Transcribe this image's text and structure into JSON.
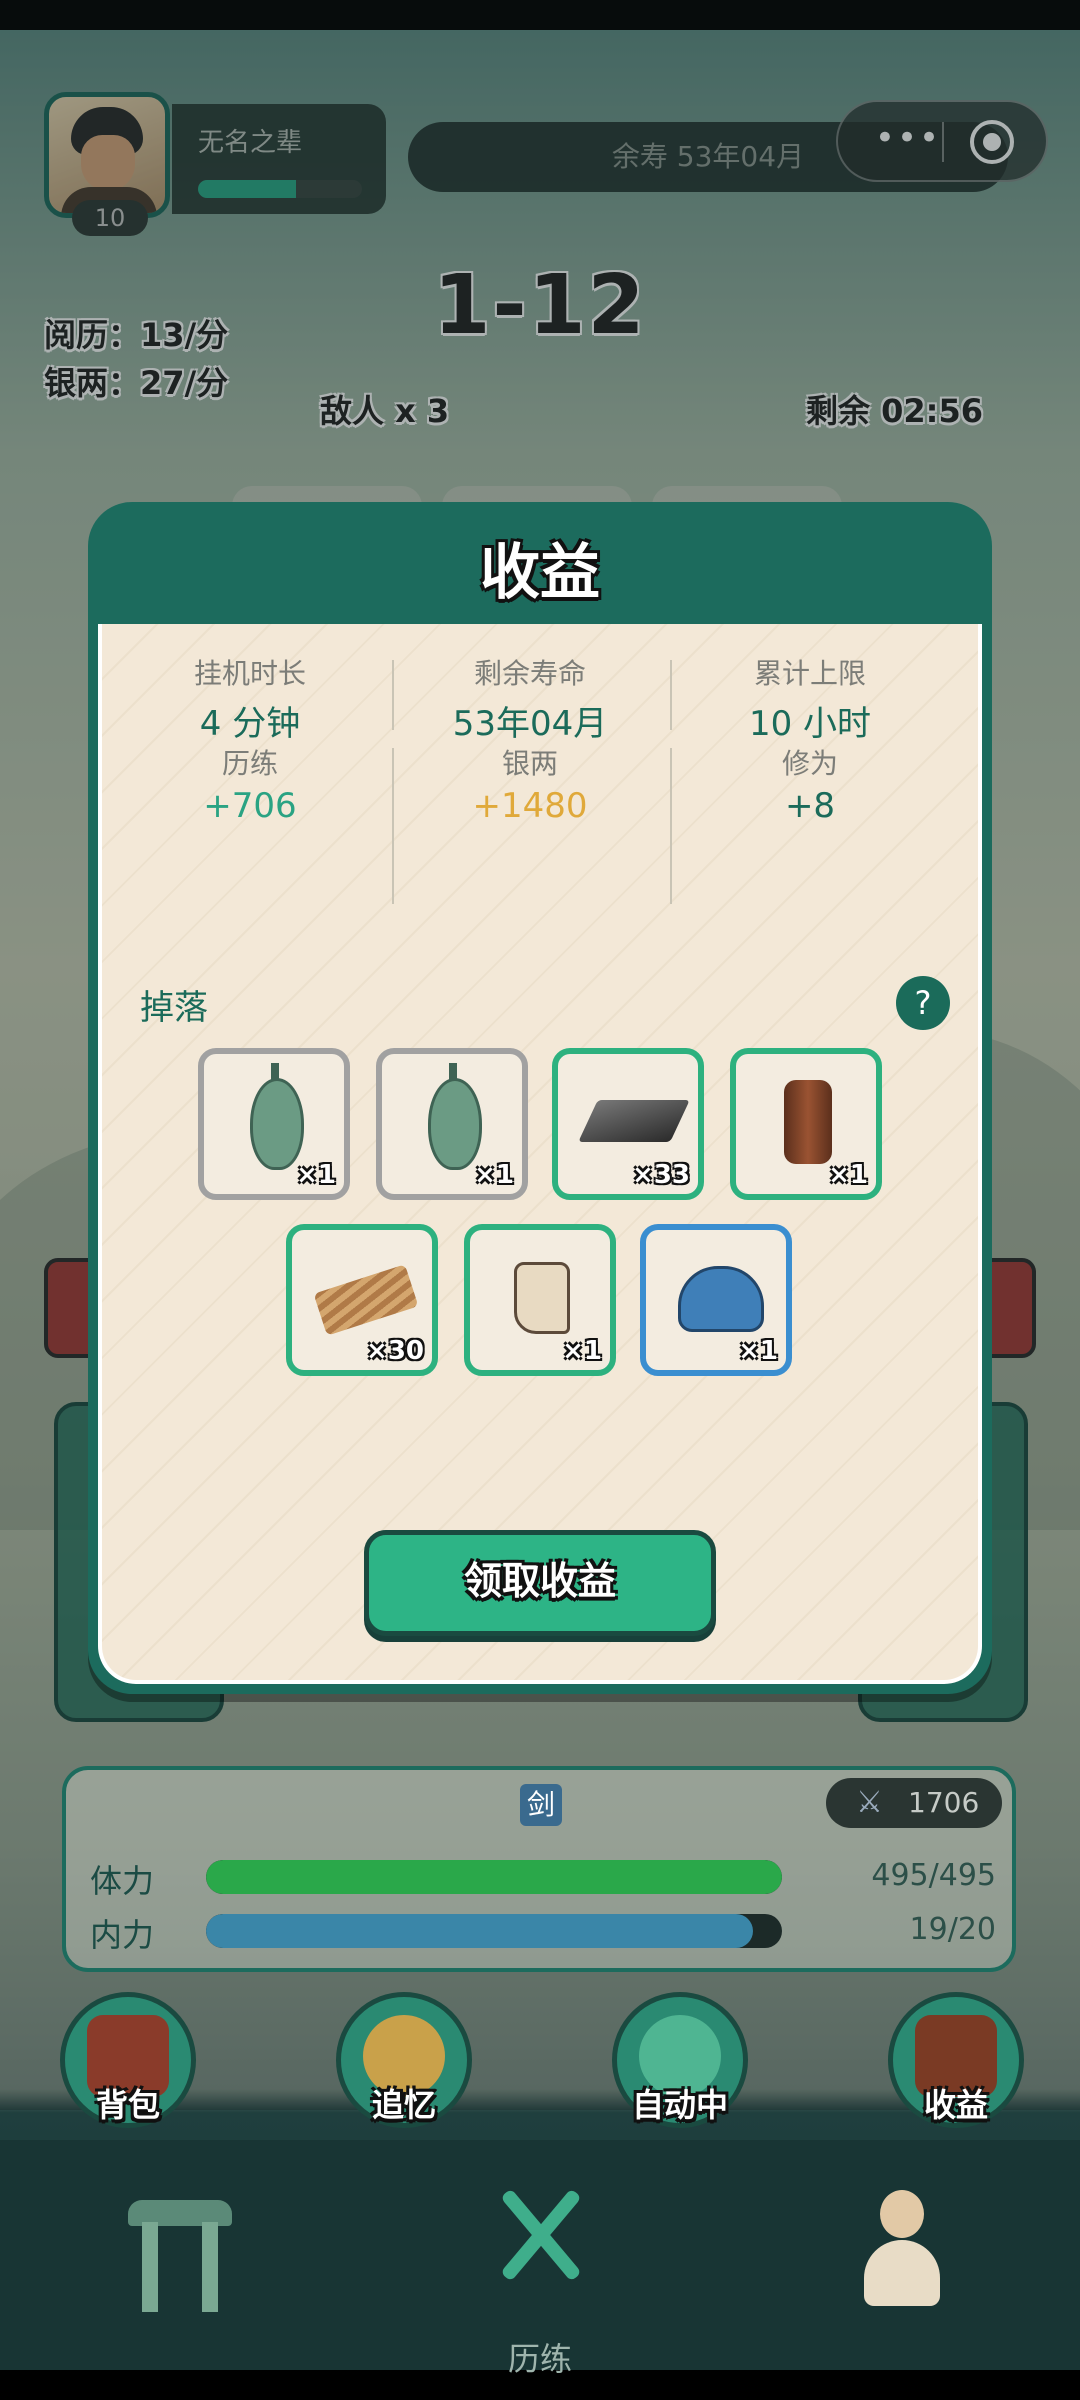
{
  "header": {
    "player_name": "无名之辈",
    "level": "10",
    "name_progress": 0.6,
    "remaining_life": "余寿 53年04月",
    "more_icon": "more-dots-icon",
    "close_icon": "target-circle-icon"
  },
  "battle": {
    "stage": "1-12",
    "experience_rate": "阅历：13/分",
    "silver_rate": "银两：27/分",
    "enemies": "敌人 x 3",
    "remaining_time": "剩余 02:56"
  },
  "modal": {
    "title": "收益",
    "stats": [
      {
        "label": "挂机时长",
        "value": "4 分钟",
        "color": "#1b6b5a"
      },
      {
        "label": "剩余寿命",
        "value": "53年04月",
        "color": "#1b6b5a"
      },
      {
        "label": "累计上限",
        "value": "10 小时",
        "color": "#1b6b5a"
      },
      {
        "label": "历练",
        "value": "+706",
        "color": "#2aa383"
      },
      {
        "label": "银两",
        "value": "+1480",
        "color": "#e0a93a"
      },
      {
        "label": "修为",
        "value": "+8",
        "color": "#1b6b5a"
      }
    ],
    "drops_label": "掉落",
    "help_label": "?",
    "items": [
      {
        "name": "jade-pendant-icon",
        "count": "×1",
        "rarity": "gray"
      },
      {
        "name": "jade-pendant-icon",
        "count": "×1",
        "rarity": "gray"
      },
      {
        "name": "iron-ingot-icon",
        "count": "×33",
        "rarity": "green"
      },
      {
        "name": "leather-bracer-icon",
        "count": "×1",
        "rarity": "green"
      },
      {
        "name": "wood-sticks-icon",
        "count": "×30",
        "rarity": "green"
      },
      {
        "name": "cloth-boot-icon",
        "count": "×1",
        "rarity": "green"
      },
      {
        "name": "blue-hat-icon",
        "count": "×1",
        "rarity": "blue"
      }
    ],
    "claim_button": "领取收益"
  },
  "panel": {
    "weapon": "剑",
    "power": "1706",
    "stamina_label": "体力",
    "stamina_value": "495/495",
    "stamina_ratio": 1.0,
    "inner_label": "内力",
    "inner_value": "19/20",
    "inner_ratio": 0.95
  },
  "actions": [
    "背包",
    "追忆",
    "自动中",
    "收益"
  ],
  "tabs": {
    "active_label": "历练"
  },
  "colors": {
    "accent": "#1c6b5d",
    "stamina": "#2aa84a",
    "inner": "#3a86a8"
  }
}
